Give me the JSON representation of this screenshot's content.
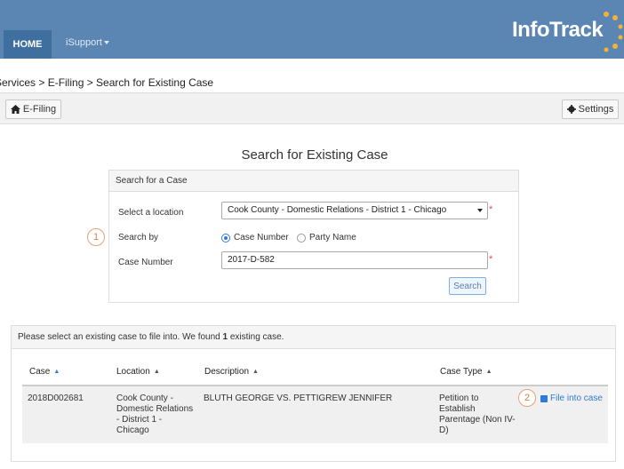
{
  "nav": {
    "home": "HOME",
    "isupport": "iSupport",
    "logo": "InfoTrack"
  },
  "breadcrumb": "Services > E-Filing > Search for Existing Case",
  "toolbar": {
    "efiling": "E-Filing",
    "settings": "Settings"
  },
  "page_title": "Search for Existing Case",
  "search_panel": {
    "header": "Search for a Case",
    "location_label": "Select a location",
    "location_value": "Cook County - Domestic Relations - District 1 - Chicago",
    "search_by_label": "Search by",
    "option_case_number": "Case Number",
    "option_party_name": "Party Name",
    "case_number_label": "Case Number",
    "case_number_value": "2017-D-582",
    "required_mark": "*",
    "search_button": "Search"
  },
  "callouts": {
    "one": "1",
    "two": "2"
  },
  "results": {
    "message_pre": "Please select an existing case to file into. We found ",
    "message_count": "1",
    "message_post": " existing case.",
    "columns": [
      "Case",
      "Location",
      "Description",
      "Case Type"
    ],
    "sort_glyph": "▲",
    "rows": [
      {
        "case": "2018D002681",
        "location": "Cook County - Domestic Relations - District 1 - Chicago",
        "description": "BLUTH GEORGE VS. PETTIGREW JENNIFER",
        "case_type": "Petition to Establish Parentage (Non IV-D)",
        "action": "File into case"
      }
    ]
  },
  "colors": {
    "nav_bg": "#5b86b3",
    "accent": "#2f7ad6",
    "callout": "#d87e47"
  }
}
